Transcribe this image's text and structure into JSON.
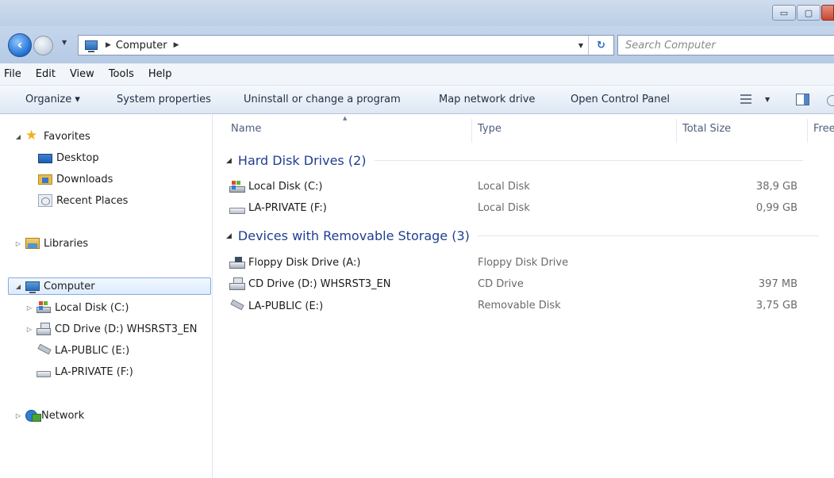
{
  "window": {
    "minimize_glyph": "▭",
    "maximize_glyph": "▢"
  },
  "address": {
    "location": "Computer",
    "search_placeholder": "Search Computer"
  },
  "menu": [
    "File",
    "Edit",
    "View",
    "Tools",
    "Help"
  ],
  "toolbar": {
    "organize": "Organize ▾",
    "system_properties": "System properties",
    "uninstall": "Uninstall or change a program",
    "map_network_drive": "Map network drive",
    "open_control_panel": "Open Control Panel"
  },
  "nav": {
    "favorites": "Favorites",
    "desktop": "Desktop",
    "downloads": "Downloads",
    "recent_places": "Recent Places",
    "libraries": "Libraries",
    "computer": "Computer",
    "computer_children": [
      "Local Disk (C:)",
      "CD Drive (D:) WHSRST3_EN",
      "LA-PUBLIC (E:)",
      "LA-PRIVATE (F:)"
    ],
    "network": "Network"
  },
  "columns": {
    "name": "Name",
    "type": "Type",
    "total_size": "Total Size",
    "free_space": "Free"
  },
  "groups": [
    {
      "title": "Hard Disk Drives (2)",
      "items": [
        {
          "name": "Local Disk (C:)",
          "type": "Local Disk",
          "size": "38,9 GB",
          "icon": "local-disk-icon"
        },
        {
          "name": "LA-PRIVATE (F:)",
          "type": "Local Disk",
          "size": "0,99 GB",
          "icon": "removable-drive-icon"
        }
      ]
    },
    {
      "title": "Devices with Removable Storage (3)",
      "items": [
        {
          "name": "Floppy Disk Drive (A:)",
          "type": "Floppy Disk Drive",
          "size": "",
          "icon": "floppy-drive-icon"
        },
        {
          "name": "CD Drive (D:) WHSRST3_EN",
          "type": "CD Drive",
          "size": "397 MB",
          "icon": "cd-drive-icon"
        },
        {
          "name": "LA-PUBLIC (E:)",
          "type": "Removable Disk",
          "size": "3,75 GB",
          "icon": "usb-drive-icon"
        }
      ]
    }
  ]
}
